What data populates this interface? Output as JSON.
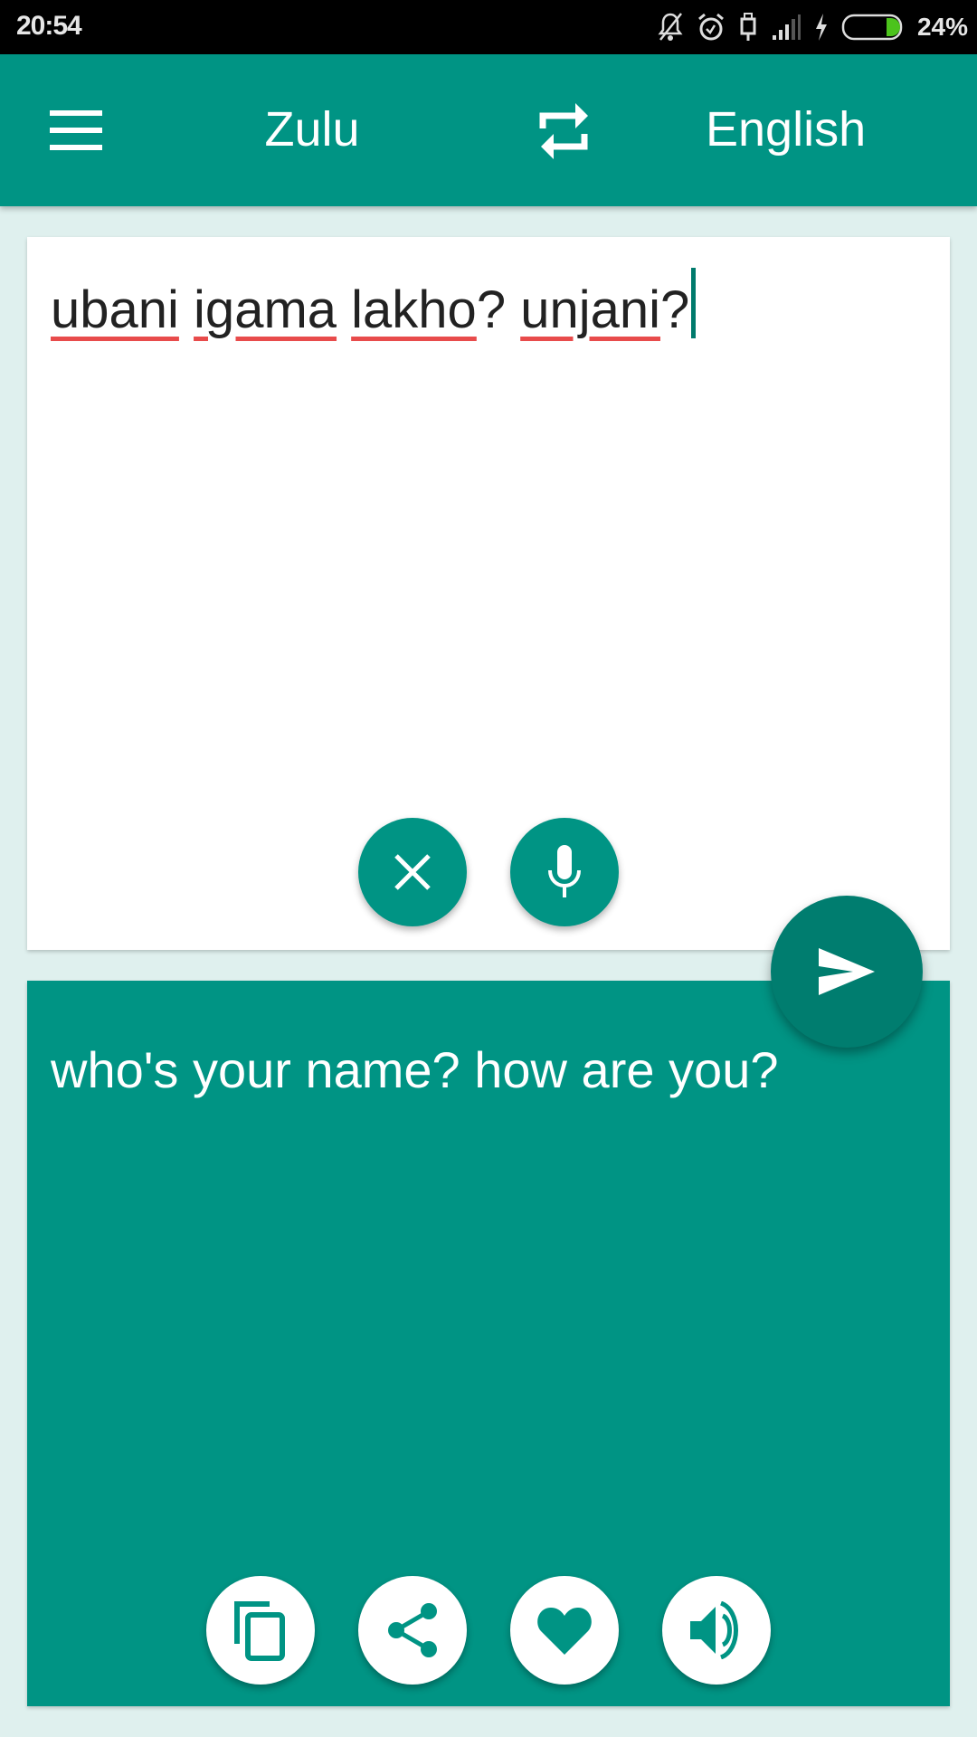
{
  "status_bar": {
    "time": "20:54",
    "icons": [
      "notifications-off-icon",
      "alarm-icon",
      "usb-icon",
      "signal-icon",
      "charging-icon",
      "battery-icon"
    ],
    "battery_percent": "24%",
    "battery_color": "#4cc31c"
  },
  "toolbar": {
    "menu_icon": "hamburger-menu-icon",
    "source_language": "Zulu",
    "swap_icon": "swap-languages-icon",
    "target_language": "English",
    "color": "#009484"
  },
  "input": {
    "words": [
      "ubani",
      "igama",
      "lakho",
      "unjani"
    ],
    "text_parts": [
      {
        "text": "ubani",
        "misspelled": true
      },
      {
        "text": " ",
        "misspelled": false
      },
      {
        "text": "igama",
        "misspelled": true
      },
      {
        "text": " ",
        "misspelled": false
      },
      {
        "text": "lakho",
        "misspelled": true
      },
      {
        "text": "? ",
        "misspelled": false
      },
      {
        "text": "unjani",
        "misspelled": true
      },
      {
        "text": "?",
        "misspelled": false
      }
    ],
    "clear_icon": "close-icon",
    "mic_icon": "microphone-icon"
  },
  "translate_button": {
    "icon": "send-icon"
  },
  "output": {
    "text": "who's your name? how are you?",
    "actions": [
      {
        "name": "copy",
        "icon": "copy-icon"
      },
      {
        "name": "share",
        "icon": "share-icon"
      },
      {
        "name": "favorite",
        "icon": "heart-icon"
      },
      {
        "name": "speak",
        "icon": "volume-icon"
      }
    ]
  }
}
